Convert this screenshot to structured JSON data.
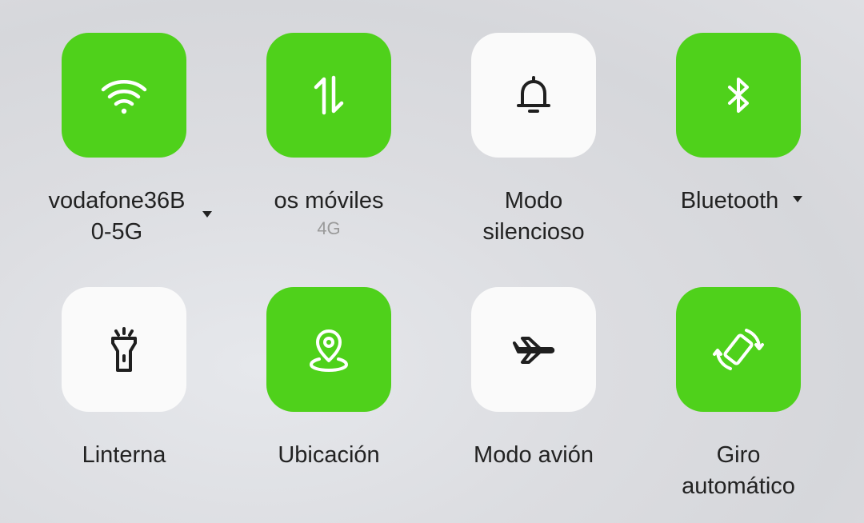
{
  "colors": {
    "active": "#4fd11b",
    "inactive": "#fafafa",
    "icon_active": "#ffffff",
    "icon_inactive": "#1f1f1f"
  },
  "tiles": [
    {
      "label_line1": "vodafone36B",
      "label_line2": "0-5G",
      "icon": "wifi-icon",
      "state": "on",
      "has_dropdown": true
    },
    {
      "label_line1": "os móviles",
      "sub": "4G",
      "icon": "mobile-data-icon",
      "state": "on"
    },
    {
      "label_line1": "Modo",
      "label_line2": "silencioso",
      "icon": "bell-icon",
      "state": "off"
    },
    {
      "label_line1": "Bluetooth",
      "icon": "bluetooth-icon",
      "state": "on",
      "has_dropdown": true
    },
    {
      "label_line1": "Linterna",
      "icon": "flashlight-icon",
      "state": "off"
    },
    {
      "label_line1": "Ubicación",
      "icon": "location-icon",
      "state": "on"
    },
    {
      "label_line1": "Modo avión",
      "icon": "airplane-icon",
      "state": "off"
    },
    {
      "label_line1": "Giro",
      "label_line2": "automático",
      "icon": "auto-rotate-icon",
      "state": "on"
    }
  ]
}
